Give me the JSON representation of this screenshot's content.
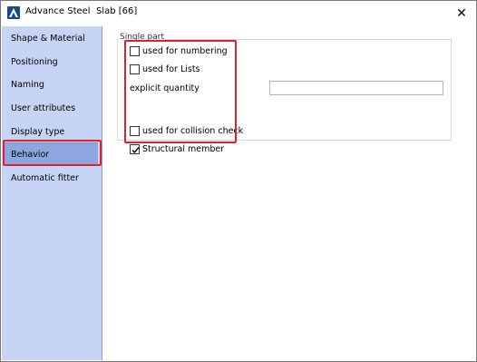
{
  "window": {
    "app_name": "Advance Steel",
    "object_title": "Slab [66]",
    "close_label": "✕"
  },
  "sidebar": {
    "items": [
      {
        "label": "Shape & Material"
      },
      {
        "label": "Positioning"
      },
      {
        "label": "Naming"
      },
      {
        "label": "User attributes"
      },
      {
        "label": "Display type"
      },
      {
        "label": "Behavior"
      },
      {
        "label": "Automatic fitter"
      }
    ],
    "selected": "Behavior"
  },
  "panel": {
    "group_label": "Single part",
    "used_for_numbering": {
      "label": "used for numbering",
      "checked": false
    },
    "used_for_lists": {
      "label": "used for Lists",
      "checked": false
    },
    "explicit_quantity": {
      "label": "explicit quantity",
      "value": ""
    },
    "used_for_collision_check": {
      "label": "used for collision check",
      "checked": false
    },
    "structural_member": {
      "label": "Structural member",
      "checked": true
    }
  },
  "colors": {
    "sidebar_bg": "#c6d4f5",
    "selected_bg": "#8ea6e0",
    "highlight": "#e0202a"
  }
}
